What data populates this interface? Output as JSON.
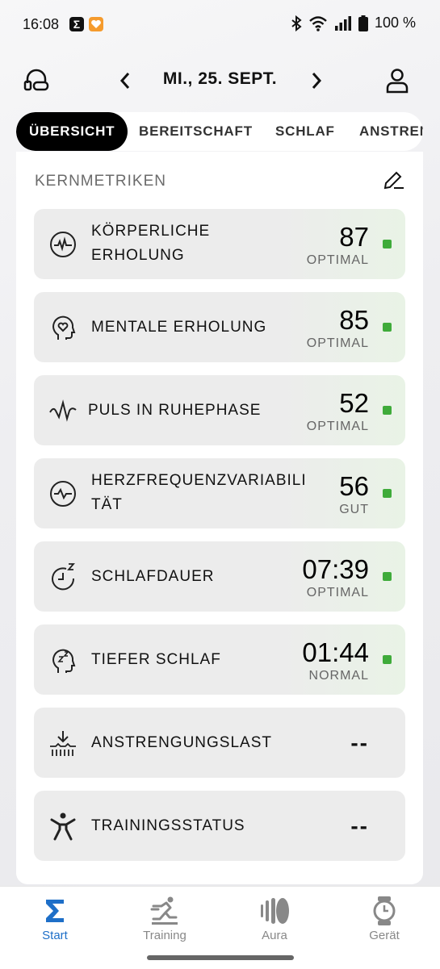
{
  "status_bar": {
    "time": "16:08",
    "battery": "100 %"
  },
  "header": {
    "date": "MI., 25. SEPT."
  },
  "tabs": [
    {
      "label": "ÜBERSICHT",
      "active": true
    },
    {
      "label": "BEREITSCHAFT"
    },
    {
      "label": "SCHLAF"
    },
    {
      "label": "ANSTREN"
    }
  ],
  "section": {
    "title": "KERNMETRIKEN"
  },
  "metrics": [
    {
      "label": "KÖRPERLICHE ERHOLUNG",
      "value": "87",
      "status": "OPTIMAL",
      "icon": "pulse-circle-icon",
      "status_color": "#3fab3a"
    },
    {
      "label": "MENTALE ERHOLUNG",
      "value": "85",
      "status": "OPTIMAL",
      "icon": "head-heart-icon",
      "status_color": "#3fab3a"
    },
    {
      "label": "PULS IN RUHEPHASE",
      "value": "52",
      "status": "OPTIMAL",
      "icon": "heartbeat-wave-icon",
      "status_color": "#3fab3a"
    },
    {
      "label": "HERZFREQUENZVARIABILITÄT",
      "label_line1": "HERZFREQUENZVARIABILI",
      "label_line2": "TÄT",
      "value": "56",
      "status": "GUT",
      "icon": "hrv-circle-icon",
      "status_color": "#3fab3a"
    },
    {
      "label": "SCHLAFDAUER",
      "value": "07:39",
      "status": "OPTIMAL",
      "icon": "sleep-clock-icon",
      "status_color": "#3fab3a"
    },
    {
      "label": "TIEFER SCHLAF",
      "value": "01:44",
      "status": "NORMAL",
      "icon": "deep-sleep-head-icon",
      "status_color": "#3fab3a"
    },
    {
      "label": "ANSTRENGUNGSLAST",
      "value": "--",
      "icon": "strain-load-icon"
    },
    {
      "label": "TRAININGSSTATUS",
      "value": "--",
      "icon": "training-figure-icon"
    }
  ],
  "nav": [
    {
      "label": "Start",
      "active": true,
      "icon": "sigma-icon"
    },
    {
      "label": "Training",
      "icon": "runner-icon"
    },
    {
      "label": "Aura",
      "icon": "aura-icon"
    },
    {
      "label": "Gerät",
      "icon": "watch-icon"
    }
  ],
  "colors": {
    "accent": "#1e6fc8",
    "status_green": "#3fab3a",
    "active_tab": "#000000"
  }
}
